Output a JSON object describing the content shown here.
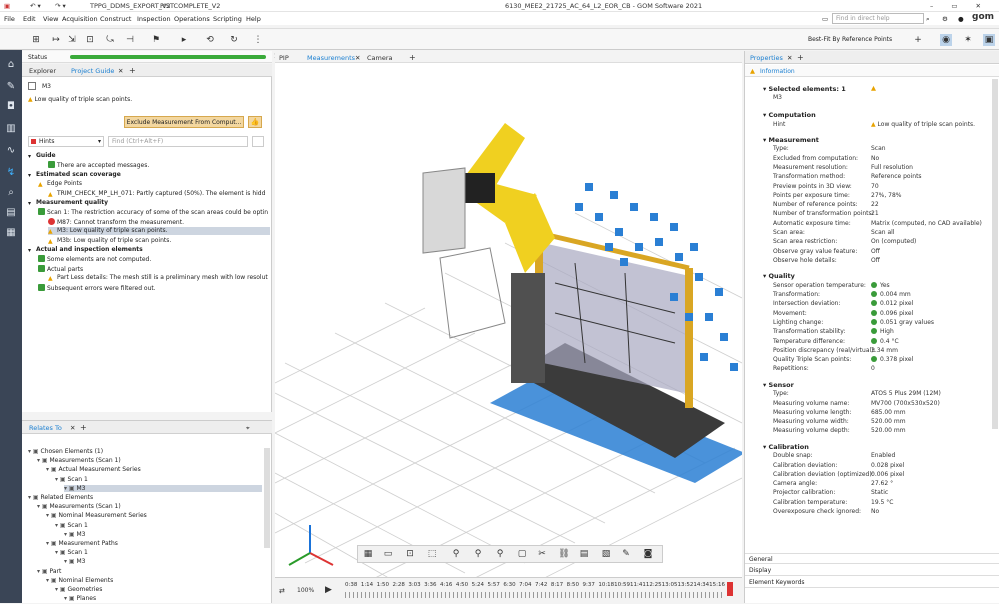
{
  "title_bar": {
    "doc1": "TPPG_DDMS_EXPORT_V2",
    "doc2": "PISTCOMPLETE_V2",
    "window_title": "6130_MEE2_21725_AC_64_L2_EOR_CB - GOM Software 2021"
  },
  "menu": [
    "File",
    "Edit",
    "View",
    "Acquisition",
    "Construct",
    "Inspection",
    "Operations",
    "Scripting",
    "Help"
  ],
  "search": {
    "placeholder": "Find in direct help"
  },
  "toolbar": {
    "alignment": "Best-Fit By Reference Points"
  },
  "status": {
    "label": "Status",
    "count": "1"
  },
  "left_tabs": [
    "Explorer",
    "Project Guide"
  ],
  "element": {
    "name": "M3",
    "message": "Low quality of triple scan points.",
    "button": "Exclude Measurement From Comput..."
  },
  "hints": {
    "label": "Hints",
    "find_placeholder": "Find (Ctrl+Alt+F)"
  },
  "guide_tree": [
    {
      "text": "Guide",
      "level": 0,
      "bold": true
    },
    {
      "text": "There are accepted messages.",
      "level": 2
    },
    {
      "text": "Estimated scan coverage",
      "level": 0,
      "bold": true
    },
    {
      "text": "Edge Points",
      "level": 1
    },
    {
      "text": "TRIM_CHECK_MP_LH_071: Partly captured (50%). The element is hidd",
      "level": 2
    },
    {
      "text": "Measurement quality",
      "level": 0,
      "bold": true
    },
    {
      "text": "Scan 1: The restriction accuracy of some of the scan areas could be optin",
      "level": 1
    },
    {
      "text": "M87: Cannot transform the measurement.",
      "level": 2
    },
    {
      "text": "M3: Low quality of triple scan points.",
      "level": 2,
      "selected": true
    },
    {
      "text": "M3b: Low quality of triple scan points.",
      "level": 2
    },
    {
      "text": "Actual and inspection elements",
      "level": 0,
      "bold": true
    },
    {
      "text": "Some elements are not computed.",
      "level": 1
    },
    {
      "text": "Actual parts",
      "level": 1
    },
    {
      "text": "Part Less details: The mesh still is a preliminary mesh with low resolut",
      "level": 2
    },
    {
      "text": "Subsequent errors were filtered out.",
      "level": 1
    }
  ],
  "relates_to": {
    "title": "Relates To"
  },
  "relates_tree": [
    {
      "text": "Chosen Elements (1)",
      "level": 0
    },
    {
      "text": "Measurements (Scan 1)",
      "level": 1
    },
    {
      "text": "Actual Measurement Series",
      "level": 2
    },
    {
      "text": "Scan 1",
      "level": 3
    },
    {
      "text": "M3",
      "level": 4,
      "selected": true
    },
    {
      "text": "Related Elements",
      "level": 0
    },
    {
      "text": "Measurements (Scan 1)",
      "level": 1
    },
    {
      "text": "Nominal Measurement Series",
      "level": 2
    },
    {
      "text": "Scan 1",
      "level": 3
    },
    {
      "text": "M3",
      "level": 4
    },
    {
      "text": "Measurement Paths",
      "level": 2
    },
    {
      "text": "Scan 1",
      "level": 3
    },
    {
      "text": "M3",
      "level": 4
    },
    {
      "text": "Part",
      "level": 1
    },
    {
      "text": "Nominal Elements",
      "level": 2
    },
    {
      "text": "Geometries",
      "level": 3
    },
    {
      "text": "Planes",
      "level": 4
    }
  ],
  "view_tabs": [
    "PIP",
    "Measurements",
    "Camera"
  ],
  "zoom": "100%",
  "timeline": [
    "0:38",
    "1:14",
    "1:50",
    "2:28",
    "3:03",
    "3:36",
    "4:16",
    "4:50",
    "5:24",
    "5:57",
    "6:30",
    "7:04",
    "7:42",
    "8:17",
    "8:50",
    "9:37",
    "10:18",
    "10:59",
    "11:41",
    "12:25",
    "13:05",
    "13:52",
    "14:34",
    "15:16"
  ],
  "properties": {
    "tab": "Properties",
    "sub_tab": "Information",
    "selected_label": "Selected elements: 1",
    "selected_value": "M3",
    "sections": [
      {
        "title": "Computation",
        "rows": [
          [
            "Hint",
            "Low quality of triple scan points."
          ]
        ]
      },
      {
        "title": "Measurement",
        "rows": [
          [
            "Type:",
            "Scan"
          ],
          [
            "Excluded from computation:",
            "No"
          ],
          [
            "Measurement resolution:",
            "Full resolution"
          ],
          [
            "Transformation method:",
            "Reference points"
          ],
          [
            "Preview points in 3D view:",
            "70"
          ],
          [
            "Points per exposure time:",
            "27%, 78%"
          ],
          [
            "Number of reference points:",
            "22"
          ],
          [
            "Number of transformation points:",
            "21"
          ],
          [
            "Automatic exposure time:",
            "Matrix (computed, no CAD available)"
          ],
          [
            "Scan area:",
            "Scan all"
          ],
          [
            "Scan area restriction:",
            "On (computed)"
          ],
          [
            "Observe gray value feature:",
            "Off"
          ],
          [
            "Observe hole details:",
            "Off"
          ]
        ]
      },
      {
        "title": "Quality",
        "rows": [
          [
            "Sensor operation temperature:",
            "Yes"
          ],
          [
            "Transformation:",
            "0.004 mm"
          ],
          [
            "Intersection deviation:",
            "0.012 pixel"
          ],
          [
            "Movement:",
            "0.096 pixel"
          ],
          [
            "Lighting change:",
            "0.051 gray values"
          ],
          [
            "Transformation stability:",
            "High"
          ],
          [
            "Temperature difference:",
            "0.4 °C"
          ],
          [
            "Position discrepancy (real/virtual):",
            "3.34 mm"
          ],
          [
            "Quality Triple Scan points:",
            "0.378 pixel"
          ],
          [
            "Repetitions:",
            "0"
          ]
        ]
      },
      {
        "title": "Sensor",
        "rows": [
          [
            "Type:",
            "ATOS 5 Plus 29M (12M)"
          ],
          [
            "Measuring volume name:",
            "MV700 (700x530x520)"
          ],
          [
            "Measuring volume length:",
            "685.00 mm"
          ],
          [
            "Measuring volume width:",
            "520.00 mm"
          ],
          [
            "Measuring volume depth:",
            "520.00 mm"
          ]
        ]
      },
      {
        "title": "Calibration",
        "rows": [
          [
            "Double snap:",
            "Enabled"
          ],
          [
            "Calibration deviation:",
            "0.028 pixel"
          ],
          [
            "Calibration deviation (optimized):",
            "0.006 pixel"
          ],
          [
            "Camera angle:",
            "27.62 °"
          ],
          [
            "Projector calibration:",
            "Static"
          ],
          [
            "Calibration temperature:",
            "19.5 °C"
          ],
          [
            "Overexposure check ignored:",
            "No"
          ]
        ]
      }
    ],
    "bottom_tabs": [
      "General",
      "Display",
      "Element Keywords"
    ]
  },
  "colors": {
    "sidebar": "#3a4556",
    "accent": "#1a7fd1",
    "robot": "#f0d020",
    "frame": "#d9a623",
    "blocks": "#2a7fd4"
  }
}
